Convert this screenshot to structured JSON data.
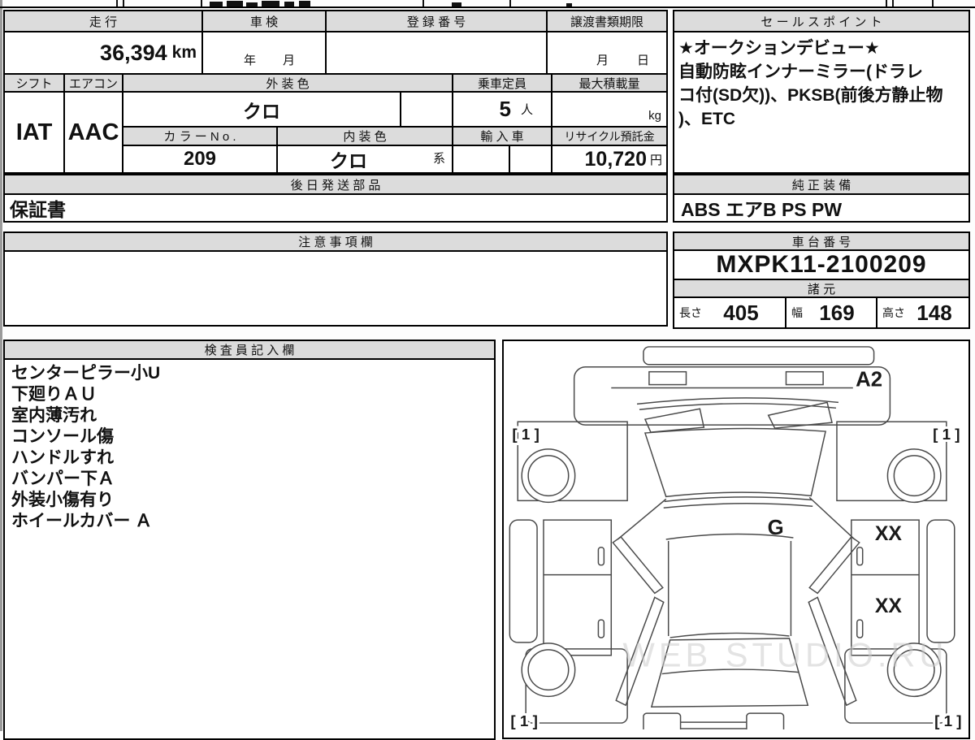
{
  "sheet": {
    "mileage": {
      "label": "走 行",
      "value": "36,394",
      "unit": "km"
    },
    "shaken": {
      "label": "車 検",
      "year_suffix": "年",
      "month_suffix": "月"
    },
    "registration": {
      "label": "登 録 番 号",
      "value": ""
    },
    "deadline": {
      "label": "譲渡書類期限",
      "month_suffix": "月",
      "day_suffix": "日"
    },
    "shift": {
      "label": "シフト",
      "value": "IAT"
    },
    "aircon": {
      "label": "エアコン",
      "value": "AAC"
    },
    "exterior_color": {
      "label": "外 装 色",
      "value": "クロ"
    },
    "capacity": {
      "label": "乗車定員",
      "value": "5",
      "unit": "人"
    },
    "max_load": {
      "label": "最大積載量",
      "unit": "kg"
    },
    "color_no": {
      "label": "カ ラ ー N o .",
      "value": "209"
    },
    "interior_color": {
      "label": "内 装 色",
      "value": "クロ",
      "suffix": "系"
    },
    "import_car": {
      "label": "輸 入 車"
    },
    "recycle_deposit": {
      "label": "リサイクル預託金",
      "value": "10,720",
      "unit": "円"
    },
    "later_parts": {
      "label": "後 日 発 送 部 品",
      "value": "保証書"
    },
    "caution": {
      "label": "注 意 事 項 欄",
      "value": ""
    },
    "sales_point": {
      "label": "セ ー ル ス ポ イ ン ト",
      "lines": [
        "★オークションデビュー★",
        "自動防眩インナーミラー(ドラレ",
        "コ付(SD欠))、PKSB(前後方静止物",
        ")、ETC"
      ]
    },
    "equipment": {
      "label": "純 正 装 備",
      "value": "ABS エアB PS PW"
    },
    "chassis_no": {
      "label": "車 台 番 号",
      "value": "MXPK11-2100209"
    },
    "specs": {
      "label": "諸 元",
      "length_label": "長さ",
      "length": "405",
      "width_label": "幅",
      "width": "169",
      "height_label": "高さ",
      "height": "148"
    },
    "inspector": {
      "label": "検 査 員 記 入 欄",
      "lines": [
        "センターピラー小U",
        "下廻りＡＵ",
        "室内薄汚れ",
        "コンソール傷",
        "ハンドルすれ",
        "バンパー下Ａ",
        "外装小傷有り",
        "ホイールカバー Ａ"
      ]
    }
  },
  "diagram": {
    "front_bumper_mark": "A2",
    "tire_front_left": "[ 1 ]",
    "tire_front_right": "[ 1 ]",
    "tire_rear_left": "[ 1 ]",
    "tire_rear_right": "[ 1 ]",
    "windshield_mark": "G",
    "door_right_upper_mark": "XX",
    "door_right_lower_mark": "XX",
    "watermark": "WEB STUDIO.RU"
  },
  "colors": {
    "header_bg": "#dcdcdc",
    "border": "#000000",
    "diagram_line": "#4a4a4a",
    "watermark": "#cccccc"
  }
}
